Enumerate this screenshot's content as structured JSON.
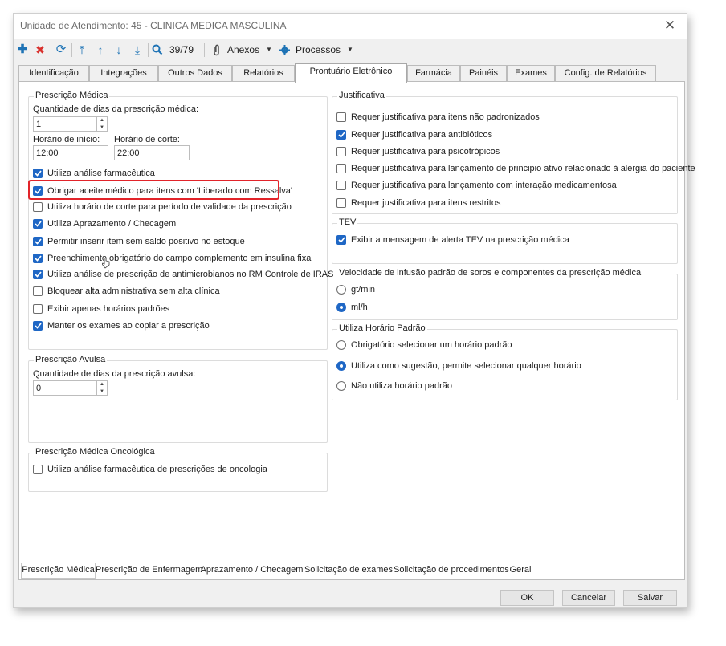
{
  "window": {
    "title": "Unidade de Atendimento: 45 - CLINICA MEDICA MASCULINA",
    "close_glyph": "✕"
  },
  "toolbar": {
    "add_glyph": "✚",
    "delete_glyph": "✖",
    "refresh_glyph": "⟳",
    "first_glyph": "⤒",
    "prev_glyph": "↑",
    "next_glyph": "↓",
    "last_glyph": "⤓",
    "search_glyph": "🔍",
    "record_counter": "39/79",
    "anexos_label": "Anexos",
    "processos_label": "Processos",
    "dropdown_glyph": "▼"
  },
  "tabs_top": [
    "Identificação",
    "Integrações",
    "Outros Dados",
    "Relatórios",
    "Prontuário Eletrônico",
    "Farmácia",
    "Painéis",
    "Exames",
    "Config. de Relatórios"
  ],
  "active_top_tab": "Prontuário Eletrônico",
  "prescricao_medica": {
    "title": "Prescrição Médica",
    "dias_label": "Quantidade de dias da prescrição médica:",
    "dias_value": "1",
    "inicio_label": "Horário de início:",
    "inicio_value": "12:00",
    "corte_label": "Horário de corte:",
    "corte_value": "22:00",
    "options": [
      {
        "label": "Utiliza análise farmacêutica",
        "checked": true
      },
      {
        "label": "Obrigar aceite médico para itens com 'Liberado com Ressalva'",
        "checked": true
      },
      {
        "label": "Utiliza horário de corte para período de validade da prescrição",
        "checked": false
      },
      {
        "label": "Utiliza Aprazamento / Checagem",
        "checked": true
      },
      {
        "label": "Permitir inserir item sem saldo positivo no estoque",
        "checked": true
      },
      {
        "label": "Preenchimento obrigatório do campo complemento em insulina fixa",
        "checked": true
      },
      {
        "label": "Utiliza análise de prescrição de antimicrobianos no RM Controle de IRAS",
        "checked": true
      },
      {
        "label": "Bloquear alta administrativa sem alta clínica",
        "checked": false
      },
      {
        "label": "Exibir apenas horários padrões",
        "checked": false
      },
      {
        "label": "Manter os exames ao copiar a prescrição",
        "checked": true
      }
    ]
  },
  "prescricao_avulsa": {
    "title": "Prescrição Avulsa",
    "dias_label": "Quantidade de dias da prescrição avulsa:",
    "dias_value": "0"
  },
  "prescricao_oncologica": {
    "title": "Prescrição Médica Oncológica",
    "options": [
      {
        "label": "Utiliza análise farmacêutica de prescrições de oncologia",
        "checked": false
      }
    ]
  },
  "justificativa": {
    "title": "Justificativa",
    "options": [
      {
        "label": "Requer justificativa para itens não padronizados",
        "checked": false
      },
      {
        "label": "Requer justificativa para antibióticos",
        "checked": true
      },
      {
        "label": "Requer justificativa para psicotrópicos",
        "checked": false
      },
      {
        "label": "Requer justificativa para lançamento de principio ativo relacionado à alergia do paciente",
        "checked": false
      },
      {
        "label": "Requer justificativa para lançamento com interação medicamentosa",
        "checked": false
      },
      {
        "label": "Requer justificativa para itens restritos",
        "checked": false
      }
    ]
  },
  "tev": {
    "title": "TEV",
    "options": [
      {
        "label": "Exibir a mensagem de alerta TEV na prescrição médica",
        "checked": true
      }
    ]
  },
  "velocidade": {
    "title": "Velocidade de infusão padrão de soros e componentes da prescrição médica",
    "options": [
      {
        "label": "gt/min",
        "selected": false
      },
      {
        "label": "ml/h",
        "selected": true
      }
    ]
  },
  "horario_padrao": {
    "title": "Utiliza Horário Padrão",
    "options": [
      {
        "label": "Obrigatório selecionar um horário padrão",
        "selected": false
      },
      {
        "label": "Utiliza como sugestão, permite selecionar qualquer horário",
        "selected": true
      },
      {
        "label": "Não utiliza horário padrão",
        "selected": false
      }
    ]
  },
  "tabs_bottom": [
    "Prescrição Médica",
    "Prescrição de Enfermagem",
    "Aprazamento / Checagem",
    "Solicitação de exames",
    "Solicitação de procedimentos",
    "Geral"
  ],
  "active_bottom_tab": "Prescrição Médica",
  "buttons": {
    "ok": "OK",
    "cancel": "Cancelar",
    "save": "Salvar"
  },
  "colors": {
    "accent": "#1f67c5",
    "highlight": "#e2242a",
    "toolbar_icon": "#1e73b5",
    "delete_icon": "#d9302c"
  },
  "icons": {
    "add": "plus-icon",
    "delete": "delete-icon",
    "refresh": "refresh-icon",
    "first": "first-record-icon",
    "prev": "previous-record-icon",
    "next": "next-record-icon",
    "last": "last-record-icon",
    "search": "search-icon",
    "anexos": "paperclip-icon",
    "processos": "gear-icon"
  }
}
